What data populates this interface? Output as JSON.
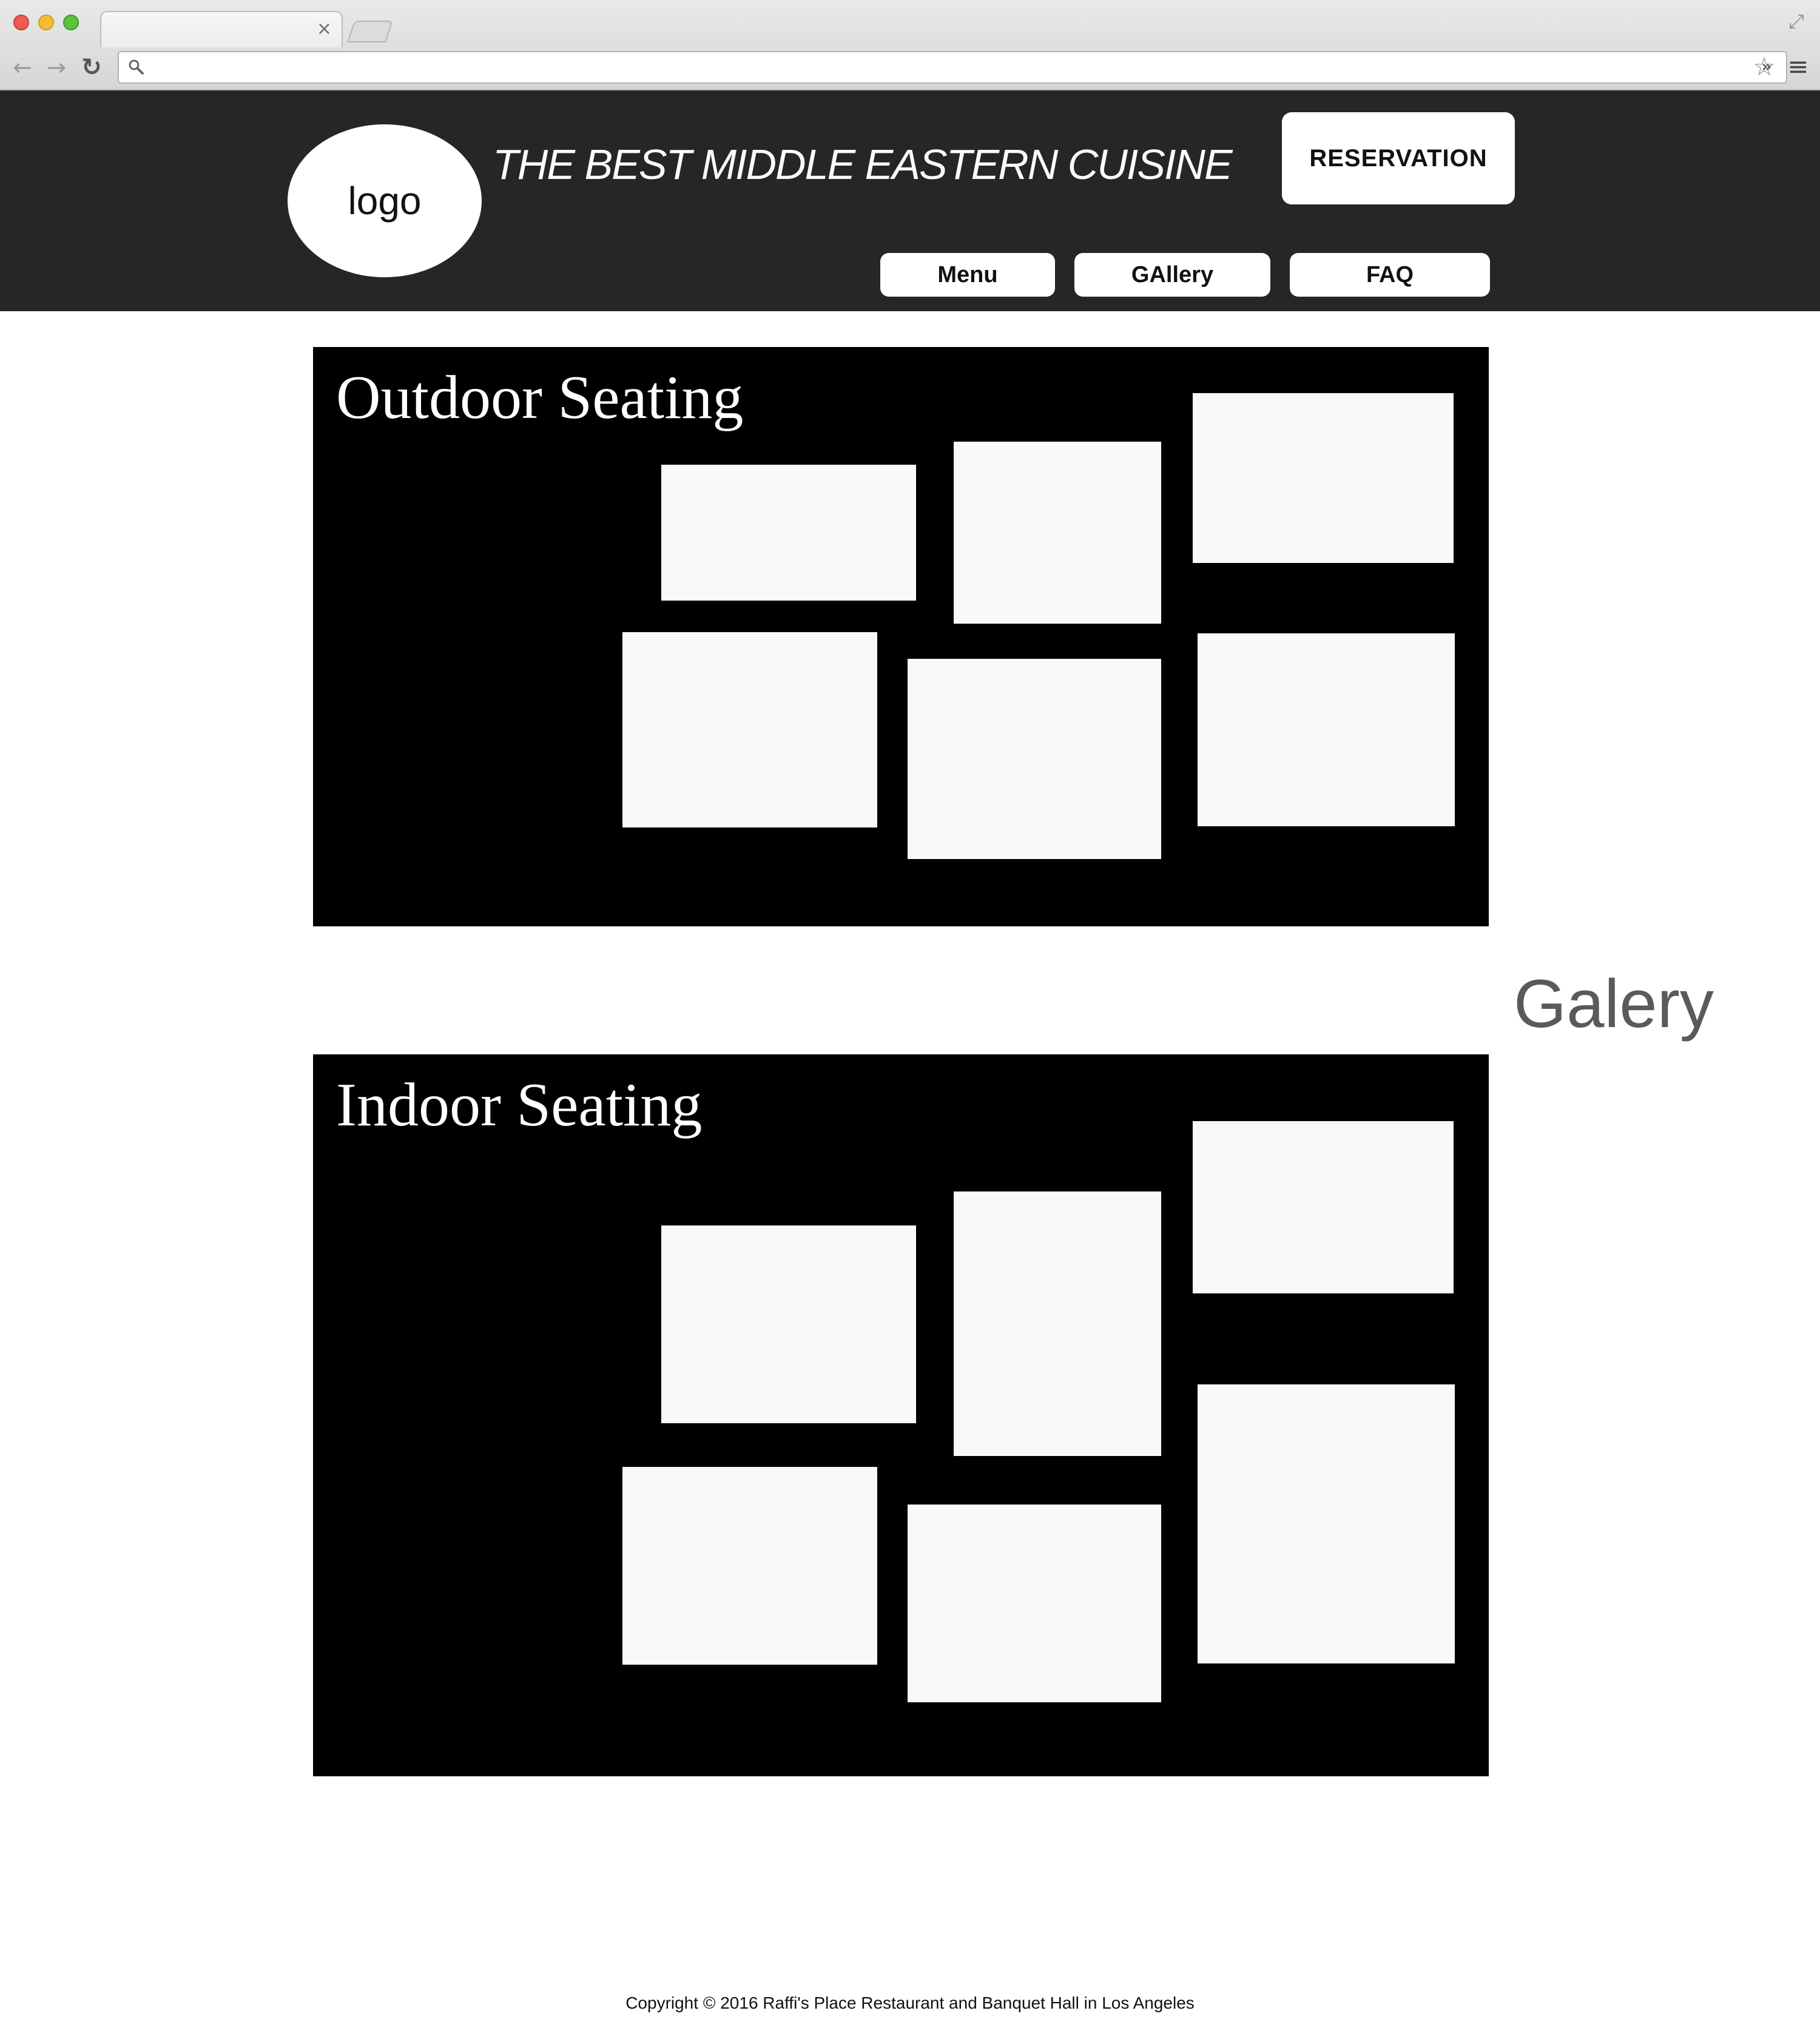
{
  "browser": {
    "tab_close": "×",
    "address_value": "",
    "address_placeholder": "",
    "icons": {
      "back": "back-arrow-icon",
      "forward": "forward-arrow-icon",
      "reload": "reload-icon",
      "search": "search-icon",
      "star": "star-icon",
      "extensions": "chevron-double-right-icon",
      "menu": "hamburger-menu-icon",
      "expand": "expand-icon"
    }
  },
  "header": {
    "logo_text": "logo",
    "tagline": "THE BEST MIDDLE EASTERN CUISINE",
    "reservation_label": "RESERVATION",
    "nav": {
      "menu": "Menu",
      "gallery": "GAllery",
      "faq": "FAQ"
    },
    "background_color": "#272627"
  },
  "gallery": {
    "side_label": "Galery",
    "sections": [
      {
        "title": "Outdoor Seating",
        "photo_count": 6
      },
      {
        "title": "Indoor Seating",
        "photo_count": 6
      }
    ],
    "photo_placeholder_color": "#f9f9fb"
  },
  "footer": {
    "copyright": "Copyright © 2016 Raffi's Place Restaurant and Banquet Hall in Los Angeles"
  }
}
